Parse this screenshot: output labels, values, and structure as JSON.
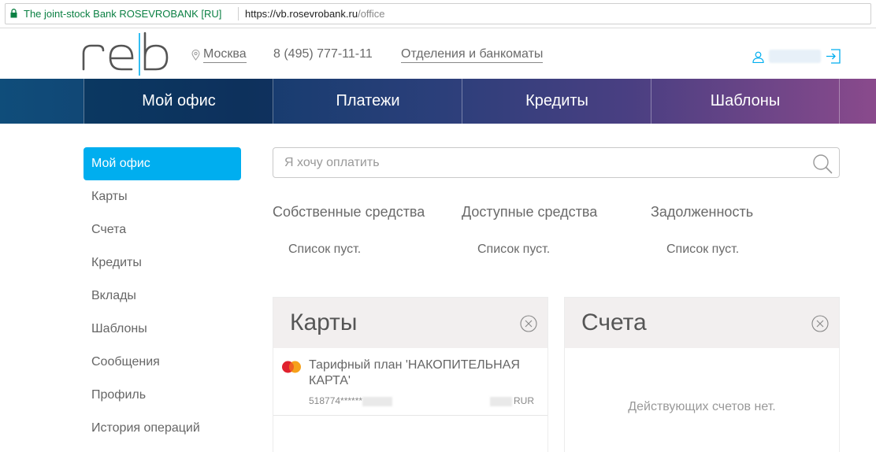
{
  "browser": {
    "site_name": "The joint-stock Bank ROSEVROBANK [RU]",
    "url_host": "https://vb.rosevrobank.ru",
    "url_path": "/office"
  },
  "header": {
    "city": "Москва",
    "phone": "8 (495) 777-11-11",
    "branches_link": "Отделения и банкоматы"
  },
  "topnav": {
    "tabs": [
      {
        "label": "Мой офис"
      },
      {
        "label": "Платежи"
      },
      {
        "label": "Кредиты"
      },
      {
        "label": "Шаблоны"
      }
    ]
  },
  "sidebar": {
    "items": [
      {
        "label": "Мой офис"
      },
      {
        "label": "Карты"
      },
      {
        "label": "Счета"
      },
      {
        "label": "Кредиты"
      },
      {
        "label": "Вклады"
      },
      {
        "label": "Шаблоны"
      },
      {
        "label": "Сообщения"
      },
      {
        "label": "Профиль"
      },
      {
        "label": "История операций"
      }
    ]
  },
  "search": {
    "placeholder": "Я хочу оплатить"
  },
  "balances": [
    {
      "label": "Собственные средства",
      "empty_text": "Список пуст."
    },
    {
      "label": "Доступные средства",
      "empty_text": "Список пуст."
    },
    {
      "label": "Задолженность",
      "empty_text": "Список пуст."
    }
  ],
  "cards_panel": {
    "title": "Карты",
    "card": {
      "name": "Тарифный план 'НАКОПИТЕЛЬНАЯ КАРТА'",
      "number_prefix": "518774******",
      "currency": "RUR"
    }
  },
  "accounts_panel": {
    "title": "Счета",
    "empty_text": "Действующих счетов нет."
  },
  "colors": {
    "accent": "#00aeef",
    "site_secure": "#0b8043"
  }
}
